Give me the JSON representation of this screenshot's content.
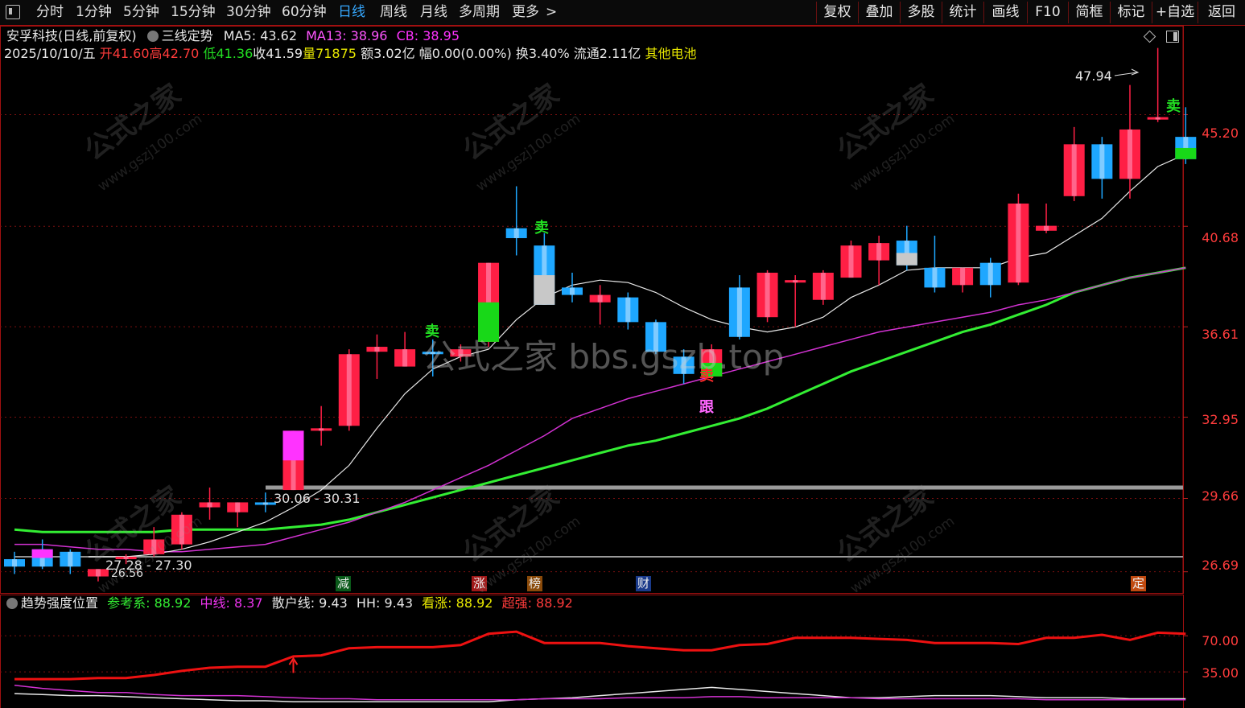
{
  "toolbar": {
    "periods": [
      "分时",
      "1分钟",
      "5分钟",
      "15分钟",
      "30分钟",
      "60分钟",
      "日线",
      "周线",
      "月线",
      "多周期",
      "更多"
    ],
    "selected": "日线",
    "more_chevron": ">",
    "right_buttons": [
      "复权",
      "叠加",
      "多股",
      "统计",
      "画线",
      "F10",
      "简框",
      "标记",
      "+自选",
      "返回"
    ]
  },
  "header": {
    "stock": "安孚科技(日线,前复权)",
    "indicator": "三线定势",
    "ma5": "MA5: 43.62",
    "ma13": "MA13: 38.96",
    "cb": "CB: 38.95",
    "date": "2025/10/10/五",
    "open": "开41.60",
    "high": "高42.70",
    "low": "低41.36",
    "close": "收41.59",
    "vol": "量71875",
    "amount": "额3.02亿",
    "amp": "幅0.00(0.00%)",
    "turnover": "换3.40%",
    "float": "流通2.11亿",
    "concept": "其他电池"
  },
  "axis": {
    "main_ticks": [
      "45.20",
      "40.68",
      "36.61",
      "32.95",
      "29.66",
      "26.69"
    ],
    "sub_ticks": [
      "70.00",
      "35.00"
    ]
  },
  "annotations": {
    "high_price": "47.94",
    "range_upper": "30.06 - 30.31",
    "range_lower": "27.28 - 27.30",
    "low_price": "26.56",
    "signals": [
      "卖",
      "卖",
      "卖",
      "卖",
      "跟",
      "卖"
    ],
    "badges": [
      "减",
      "涨",
      "榜",
      "财",
      "定"
    ]
  },
  "sub": {
    "name": "趋势强度位置",
    "ref": "参考系: 88.92",
    "mid": "中线: 8.37",
    "retail": "散户线: 9.43",
    "hh": "HH: 9.43",
    "bull": "看涨: 88.92",
    "strong": "超强: 88.92"
  },
  "watermark": {
    "site": "公式之家 bbs.gszb.top",
    "logo": "公式之家",
    "url": "www.gszj100.com"
  },
  "colors": {
    "up": "#ff1f45",
    "down": "#1ea7ff",
    "ma5": "#e8e8e8",
    "ma13": "#d232d2",
    "cb": "#33ee33",
    "strength": "#ee1111"
  },
  "chart_data": {
    "type": "candlestick",
    "ylim": [
      25.8,
      48.8
    ],
    "candles": [
      {
        "o": 26.9,
        "c": 27.2,
        "h": 27.5,
        "l": 26.6,
        "k": "d"
      },
      {
        "o": 26.9,
        "c": 27.6,
        "h": 28.0,
        "l": 26.8,
        "k": "g",
        "t": "m"
      },
      {
        "o": 26.9,
        "c": 27.5,
        "h": 27.6,
        "l": 26.6,
        "k": "d"
      },
      {
        "o": 26.8,
        "c": 26.5,
        "h": 26.8,
        "l": 26.3,
        "k": "u"
      },
      {
        "o": 27.3,
        "c": 27.2,
        "h": 27.4,
        "l": 27.0,
        "k": "u"
      },
      {
        "o": 27.4,
        "c": 28.0,
        "h": 28.5,
        "l": 27.3,
        "k": "u"
      },
      {
        "o": 27.8,
        "c": 29.0,
        "h": 29.1,
        "l": 27.6,
        "k": "u"
      },
      {
        "o": 29.5,
        "c": 29.3,
        "h": 30.1,
        "l": 28.8,
        "k": "u"
      },
      {
        "o": 29.5,
        "c": 29.1,
        "h": 29.5,
        "l": 28.5,
        "k": "u"
      },
      {
        "o": 29.4,
        "c": 29.5,
        "h": 29.9,
        "l": 29.1,
        "k": "d"
      },
      {
        "o": 30.0,
        "c": 32.4,
        "h": 32.4,
        "l": 30.0,
        "k": "u",
        "t": "m"
      },
      {
        "o": 32.4,
        "c": 32.5,
        "h": 33.4,
        "l": 31.8,
        "k": "u"
      },
      {
        "o": 32.6,
        "c": 35.5,
        "h": 35.7,
        "l": 32.4,
        "k": "u"
      },
      {
        "o": 35.6,
        "c": 35.8,
        "h": 36.3,
        "l": 34.5,
        "k": "u"
      },
      {
        "o": 35.7,
        "c": 35.0,
        "h": 36.4,
        "l": 35.0,
        "k": "u"
      },
      {
        "o": 35.6,
        "c": 35.5,
        "h": 36.1,
        "l": 34.6,
        "k": "d"
      },
      {
        "o": 35.4,
        "c": 35.7,
        "h": 35.9,
        "l": 35.2,
        "k": "u"
      },
      {
        "o": 36.0,
        "c": 39.2,
        "h": 39.2,
        "l": 35.8,
        "k": "u",
        "t": "g"
      },
      {
        "o": 40.2,
        "c": 40.6,
        "h": 42.3,
        "l": 39.5,
        "k": "d"
      },
      {
        "o": 37.5,
        "c": 39.9,
        "h": 40.4,
        "l": 37.5,
        "k": "d",
        "t": "w"
      },
      {
        "o": 37.9,
        "c": 38.2,
        "h": 38.8,
        "l": 37.6,
        "k": "d"
      },
      {
        "o": 37.9,
        "c": 37.6,
        "h": 38.3,
        "l": 36.7,
        "k": "u"
      },
      {
        "o": 37.8,
        "c": 36.8,
        "h": 38.0,
        "l": 36.5,
        "k": "d"
      },
      {
        "o": 36.8,
        "c": 35.6,
        "h": 36.9,
        "l": 35.5,
        "k": "d"
      },
      {
        "o": 35.4,
        "c": 34.7,
        "h": 35.7,
        "l": 34.3,
        "k": "d"
      },
      {
        "o": 35.7,
        "c": 34.6,
        "h": 35.9,
        "l": 34.5,
        "k": "u",
        "t": "g"
      },
      {
        "o": 36.2,
        "c": 38.2,
        "h": 38.7,
        "l": 36.1,
        "k": "d"
      },
      {
        "o": 37.0,
        "c": 38.8,
        "h": 38.9,
        "l": 36.8,
        "k": "u"
      },
      {
        "o": 38.5,
        "c": 38.4,
        "h": 38.7,
        "l": 36.6,
        "k": "u"
      },
      {
        "o": 38.8,
        "c": 37.7,
        "h": 38.9,
        "l": 37.5,
        "k": "u"
      },
      {
        "o": 38.6,
        "c": 39.9,
        "h": 40.1,
        "l": 38.6,
        "k": "u"
      },
      {
        "o": 39.3,
        "c": 40.0,
        "h": 40.3,
        "l": 38.3,
        "k": "u"
      },
      {
        "o": 40.1,
        "c": 39.1,
        "h": 40.7,
        "l": 38.9,
        "k": "d",
        "t": "w"
      },
      {
        "o": 38.2,
        "c": 39.0,
        "h": 40.3,
        "l": 38.0,
        "k": "d"
      },
      {
        "o": 39.0,
        "c": 38.3,
        "h": 39.0,
        "l": 38.0,
        "k": "u"
      },
      {
        "o": 39.2,
        "c": 38.3,
        "h": 39.4,
        "l": 37.8,
        "k": "d"
      },
      {
        "o": 38.4,
        "c": 41.6,
        "h": 42.0,
        "l": 38.3,
        "k": "u"
      },
      {
        "o": 40.7,
        "c": 40.5,
        "h": 41.6,
        "l": 40.4,
        "k": "u"
      },
      {
        "o": 41.9,
        "c": 44.0,
        "h": 44.7,
        "l": 41.7,
        "k": "u"
      },
      {
        "o": 42.6,
        "c": 44.0,
        "h": 44.3,
        "l": 41.8,
        "k": "d"
      },
      {
        "o": 42.6,
        "c": 44.6,
        "h": 46.4,
        "l": 41.8,
        "k": "u"
      },
      {
        "o": 45.0,
        "c": 45.1,
        "h": 47.9,
        "l": 44.9,
        "k": "u"
      },
      {
        "o": 43.4,
        "c": 44.3,
        "h": 45.5,
        "l": 43.2,
        "k": "d",
        "t": "g"
      }
    ],
    "ma5": [
      27.3,
      27.3,
      27.3,
      27.3,
      27.3,
      27.4,
      27.6,
      27.9,
      28.3,
      28.7,
      29.3,
      30.0,
      31.0,
      32.5,
      33.9,
      34.9,
      35.4,
      35.7,
      36.9,
      37.8,
      38.3,
      38.5,
      38.4,
      38.0,
      37.4,
      36.9,
      36.6,
      36.4,
      36.6,
      37.0,
      37.8,
      38.3,
      38.9,
      39.0,
      39.0,
      39.0,
      39.4,
      39.6,
      40.3,
      41.0,
      42.1,
      43.1,
      43.6
    ],
    "ma13": [
      27.8,
      27.8,
      27.7,
      27.6,
      27.6,
      27.5,
      27.5,
      27.6,
      27.7,
      27.8,
      28.1,
      28.4,
      28.7,
      29.1,
      29.5,
      30.0,
      30.5,
      31.0,
      31.6,
      32.2,
      32.9,
      33.3,
      33.7,
      34.0,
      34.3,
      34.6,
      34.9,
      35.2,
      35.5,
      35.8,
      36.1,
      36.4,
      36.6,
      36.8,
      37.0,
      37.2,
      37.5,
      37.7,
      38.0,
      38.3,
      38.6,
      38.8,
      39.0
    ],
    "cb": [
      28.4,
      28.3,
      28.3,
      28.3,
      28.3,
      28.3,
      28.4,
      28.4,
      28.4,
      28.4,
      28.5,
      28.6,
      28.8,
      29.1,
      29.4,
      29.7,
      30.0,
      30.3,
      30.6,
      30.9,
      31.2,
      31.5,
      31.8,
      32.0,
      32.3,
      32.6,
      32.9,
      33.3,
      33.8,
      34.3,
      34.8,
      35.2,
      35.6,
      36.0,
      36.4,
      36.7,
      37.1,
      37.5,
      38.0,
      38.3,
      38.6,
      38.8,
      39.0
    ],
    "support_lines": [
      30.1,
      27.3
    ],
    "strength": [
      28,
      28,
      28,
      29,
      29,
      32,
      36,
      39,
      40,
      40,
      50,
      51,
      58,
      59,
      59,
      59,
      61,
      72,
      74,
      63,
      63,
      63,
      60,
      58,
      56,
      56,
      61,
      62,
      68,
      68,
      68,
      67,
      66,
      63,
      63,
      63,
      62,
      68,
      68,
      71,
      66,
      73,
      72
    ],
    "mid_line": [
      22,
      19,
      17,
      15,
      15,
      13,
      12,
      12,
      12,
      11,
      10,
      9,
      9,
      8,
      8,
      8,
      8,
      8,
      8,
      9,
      9,
      9,
      10,
      10,
      10,
      11,
      11,
      10,
      10,
      10,
      10,
      9,
      9,
      9,
      9,
      9,
      9,
      8,
      8,
      8,
      8,
      8,
      8
    ],
    "retail_line": [
      14,
      13,
      12,
      12,
      11,
      10,
      9,
      8,
      7,
      7,
      6,
      6,
      6,
      6,
      6,
      6,
      6,
      6,
      8,
      9,
      10,
      12,
      14,
      16,
      18,
      20,
      18,
      16,
      14,
      12,
      10,
      10,
      11,
      12,
      12,
      12,
      11,
      10,
      10,
      10,
      9,
      9,
      9
    ],
    "sub_ylim": [
      0,
      110
    ]
  }
}
